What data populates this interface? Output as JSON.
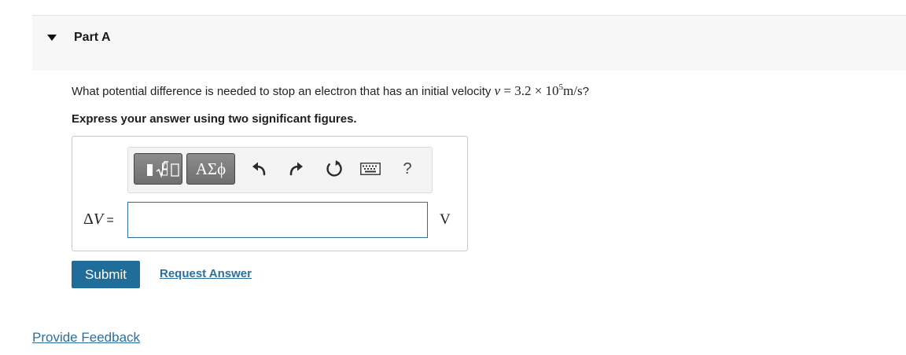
{
  "part": {
    "title": "Part A"
  },
  "question": {
    "text": "What potential difference is needed to stop an electron that has an initial velocity ",
    "math_var": "v",
    "math_rel": " = 3.2 × 10",
    "math_exp": "5",
    "math_unit": "m/s",
    "end": "?"
  },
  "instruction": "Express your answer using two significant figures.",
  "toolbar": {
    "greek_label": "ΑΣϕ",
    "help_label": "?",
    "icons": [
      "templates-icon",
      "greek-letters-icon",
      "undo-icon",
      "redo-icon",
      "reset-icon",
      "keyboard-icon",
      "help-icon"
    ]
  },
  "answer": {
    "delta": "Δ",
    "var": "V",
    "equals": " =",
    "value": "",
    "unit": "V"
  },
  "actions": {
    "submit_label": "Submit",
    "request_label": "Request Answer"
  },
  "footer": {
    "feedback_label": "Provide Feedback"
  },
  "colors": {
    "accent": "#206d9a",
    "link": "#2c6f9d",
    "input_border": "#2f6f9a",
    "header_bg": "#f7f7f7"
  }
}
